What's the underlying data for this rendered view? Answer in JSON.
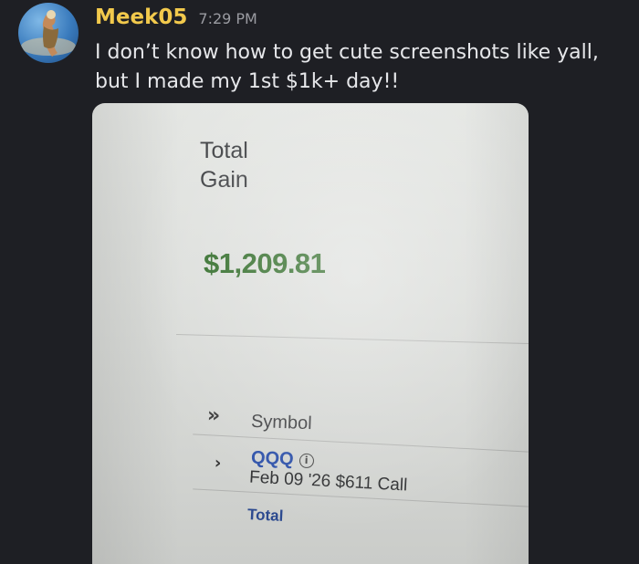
{
  "message": {
    "username": "Meek05",
    "timestamp": "7:29 PM",
    "text": "I don’t know how to get cute screenshots like yall, but I made my 1st $1k+ day!!"
  },
  "attachment": {
    "total_gain_label": "Total Gain",
    "total_gain_value": "$1,209.81",
    "expand_all_icon": "»",
    "symbol_header": "Symbol",
    "row_chevron_icon": "›",
    "ticker": "QQQ",
    "contract": "Feb 09 '26 $611 Call",
    "total_row_label": "Total",
    "colors": {
      "gain_green": "#2f6b27",
      "ticker_blue": "#2b4fa8"
    }
  },
  "colors": {
    "background": "#1e1f24",
    "username": "#f2c94c",
    "timestamp": "#9a9ba1",
    "message_text": "#e6e7ea"
  },
  "icons": {
    "avatar": "avatar",
    "info": "info-icon"
  }
}
